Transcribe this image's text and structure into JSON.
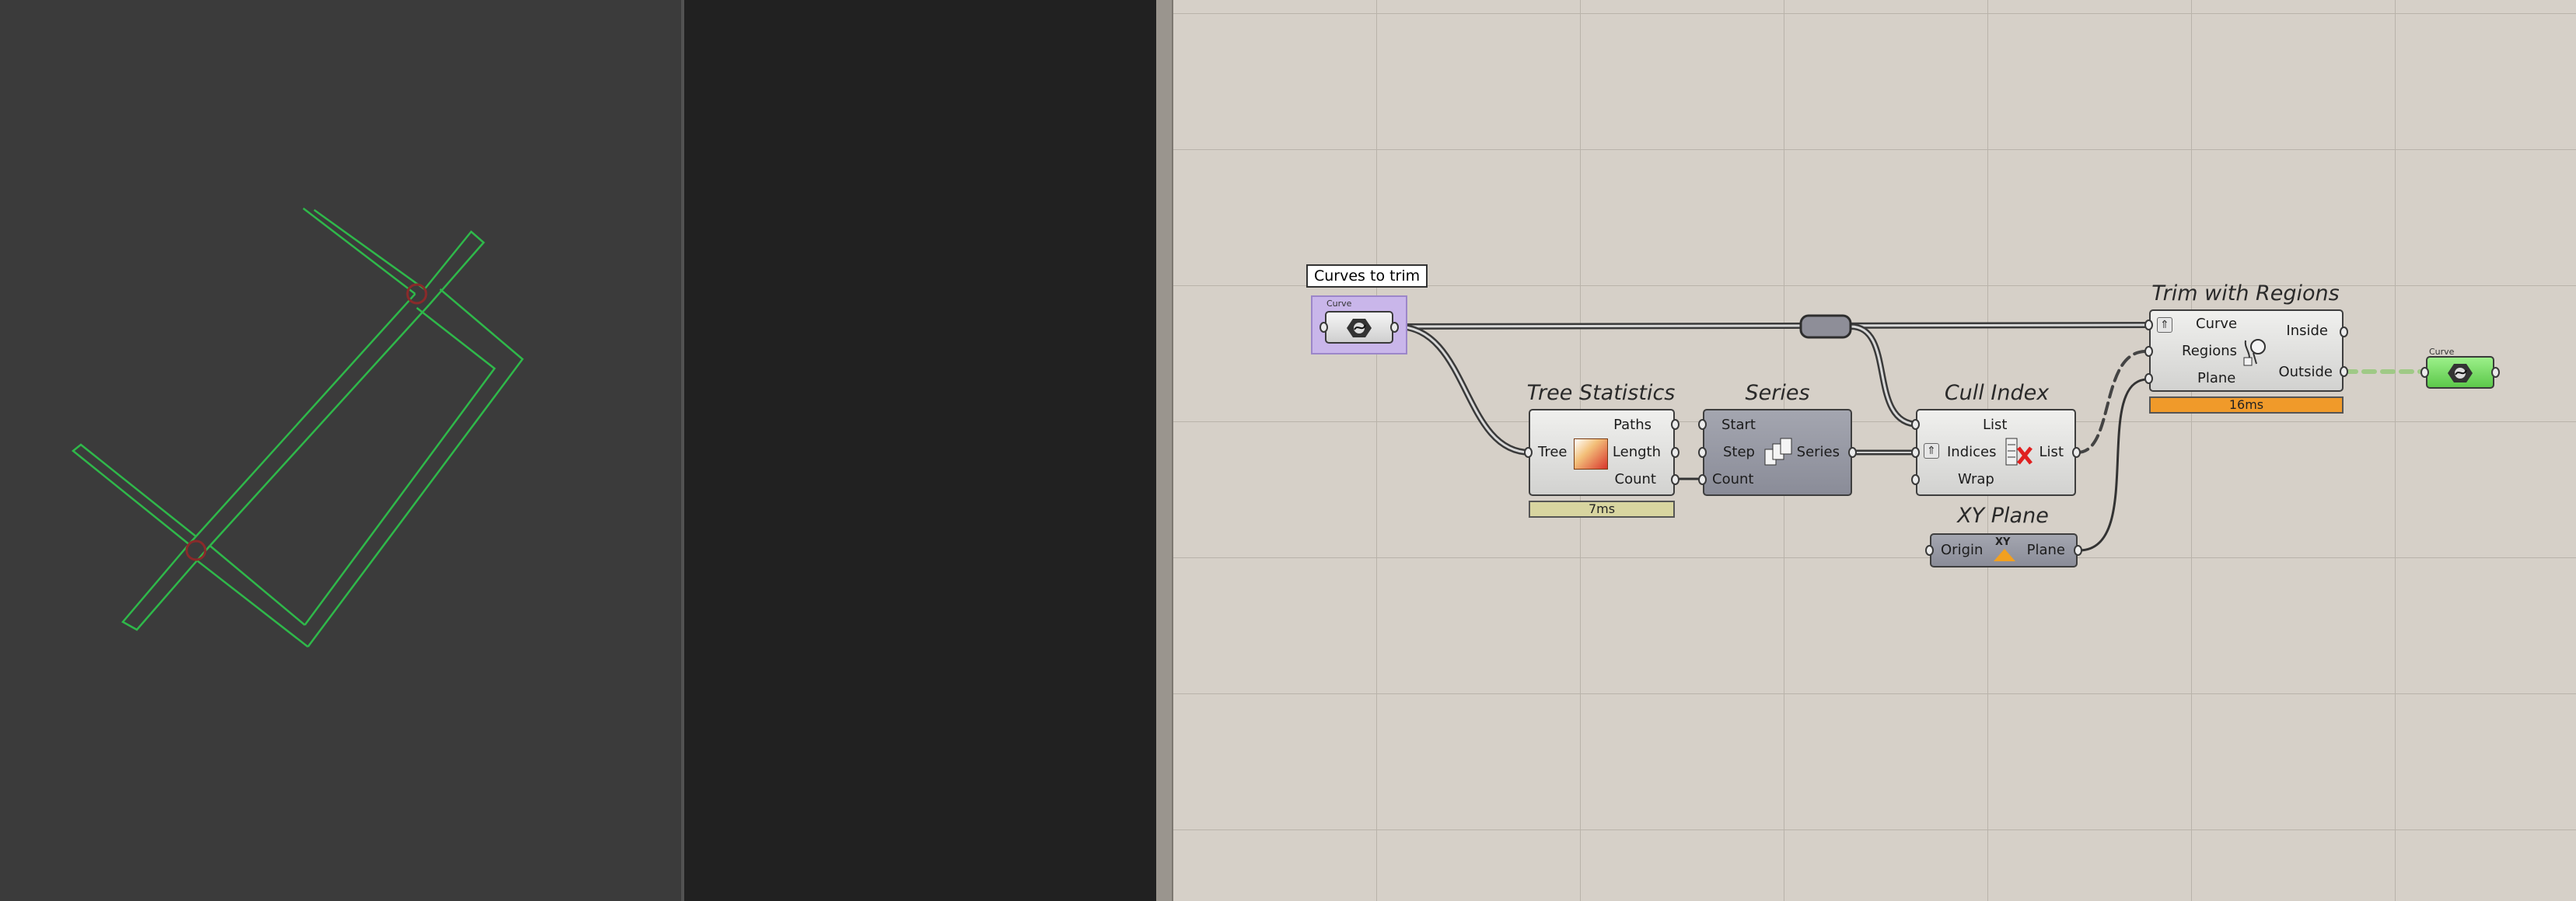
{
  "canvas": {
    "tooltip": "Curves to trim",
    "curve_param_label": "Curve",
    "output_param_label": "Curve",
    "components": {
      "tree_statistics": {
        "title": "Tree Statistics",
        "inputs": [
          "Tree"
        ],
        "outputs": [
          "Paths",
          "Length",
          "Count"
        ],
        "timer": "7ms"
      },
      "series": {
        "title": "Series",
        "inputs": [
          "Start",
          "Step",
          "Count"
        ],
        "outputs": [
          "Series"
        ]
      },
      "cull_index": {
        "title": "Cull Index",
        "inputs": [
          "List",
          "Indices",
          "Wrap"
        ],
        "outputs": [
          "List"
        ]
      },
      "xy_plane": {
        "title": "XY Plane",
        "inputs": [
          "Origin"
        ],
        "outputs": [
          "Plane"
        ],
        "icon_text": "XY"
      },
      "trim_with_regions": {
        "title": "Trim with Regions",
        "inputs": [
          "Curve",
          "Regions",
          "Plane"
        ],
        "outputs": [
          "Inside",
          "Outside"
        ],
        "timer": "16ms"
      }
    },
    "colors": {
      "canvas_bg": "#d6d0c8",
      "viewport_bg": "#3b3b3b",
      "selected_param": "#c9b6ea",
      "output_param": "#7fe06a",
      "timer_ok": "#d8d5a0",
      "timer_slow": "#f09a2a",
      "curve_preview": "#2fb84a"
    }
  }
}
